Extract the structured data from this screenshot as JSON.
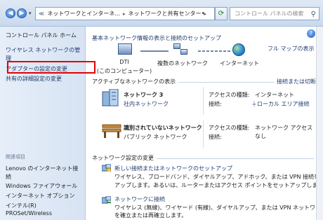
{
  "address_bar": {
    "crumbs": [
      "ネットワークとインターネ...",
      "ネットワークと共有センター"
    ],
    "search_placeholder": "コントロール パネルの検索"
  },
  "left_pane": {
    "home": "コントロール パネル ホーム",
    "wireless_manage_1": "ワイヤレス ネットワークの管",
    "wireless_manage_2": "理",
    "adapter_settings": "アダプターの設定の変更",
    "sharing_settings": "共有の詳細設定の変更",
    "related_header": "関連項目",
    "related_items": [
      "Lenovo のインターネット接",
      "続",
      "Windows ファイアウォール",
      "インターネット オプション",
      "インテル(R)",
      "PROSet/Wireless"
    ]
  },
  "main": {
    "title": "基本ネットワーク情報の表示と接続のセットアップ",
    "full_map": "フル マップの表示",
    "map": {
      "computer_name": "DTI",
      "computer_sub": "(このコンピューター)",
      "multi_network": "複数のネットワーク",
      "internet": "インターネット"
    },
    "active_header": "アクティブなネットワークの表示",
    "connect_disconnect": "接続または切断",
    "networks": [
      {
        "name": "ネットワーク 3",
        "type": "社内ネットワーク",
        "access_label": "アクセスの種類:",
        "access_value": "インターネット",
        "conn_label": "接続:",
        "conn_value": "ローカル エリア接続"
      },
      {
        "name": "識別されていないネットワーク",
        "type": "パブリック ネットワーク",
        "access_label": "アクセスの種類:",
        "access_value": "ネットワーク アクセス",
        "access_value_2": "なし",
        "conn_label": "接続:"
      }
    ],
    "change_header": "ネットワーク設定の変更",
    "tasks": [
      {
        "title": "新しい接続またはネットワークのセットアップ",
        "desc_1": "ワイヤレス、ブロードバンド、ダイヤルアップ、アドホック、または VPN 接続をセット",
        "desc_2": "アップします。あるいは、ルーターまたはアクセス ポイントをセットアップします。"
      },
      {
        "title": "ネットワークに接続",
        "desc_1": "ワイヤレス (無線)、ワイヤード (有線)、ダイヤルアップ、または VPN ネットワーク接続",
        "desc_2": "を確立または再確立します。"
      }
    ]
  },
  "colors": {
    "link": "#1e3a6e",
    "highlight_border": "#e40000"
  }
}
